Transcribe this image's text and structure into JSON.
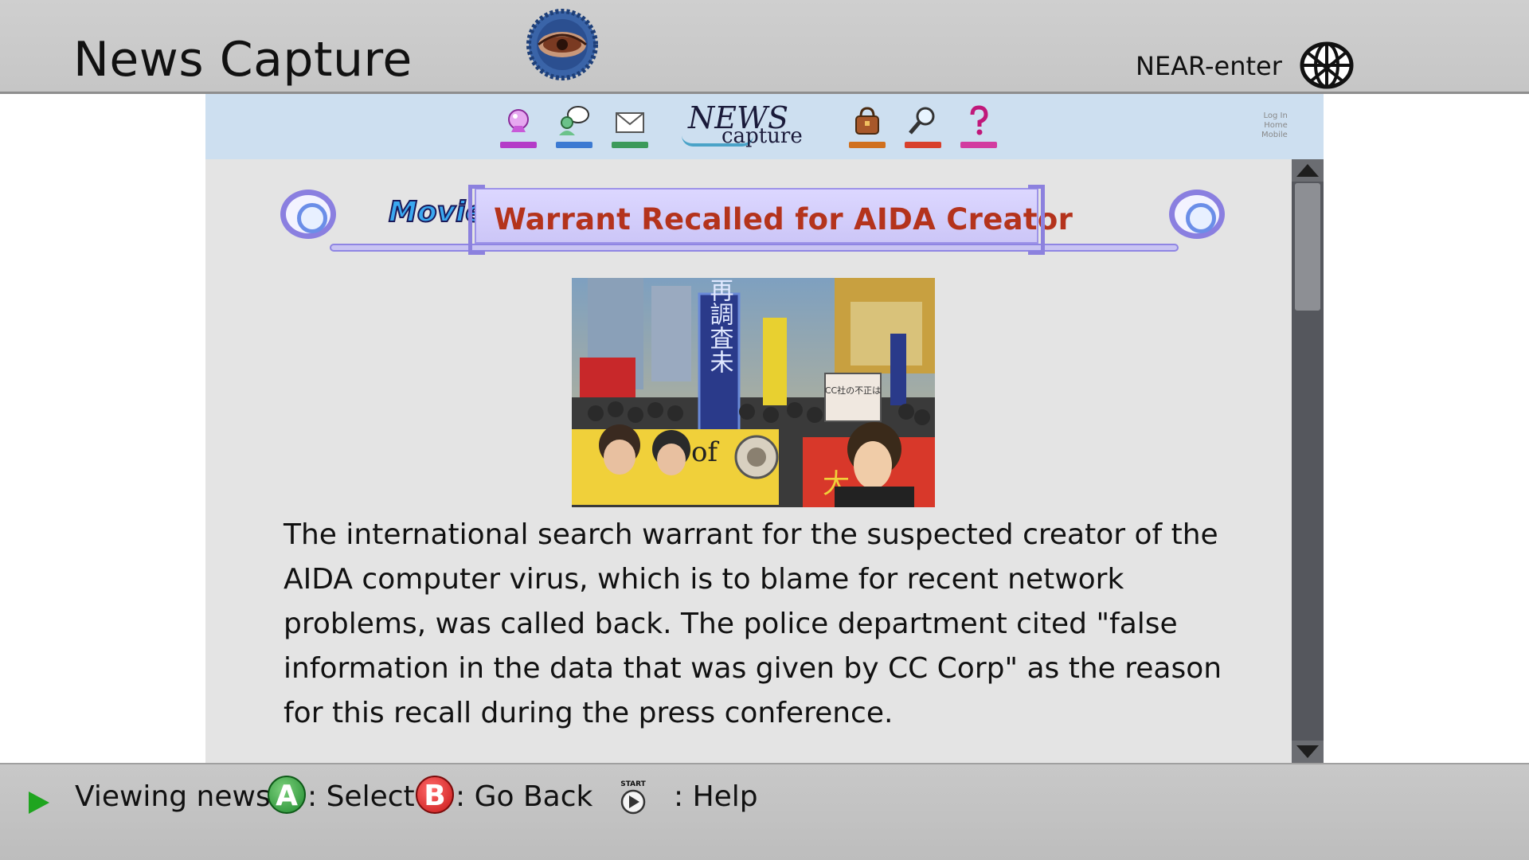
{
  "header": {
    "app_title": "News Capture",
    "network_label": "NEAR-enter",
    "logo_icon": "eye-logo-icon",
    "globe_icon": "globe-icon"
  },
  "nav": {
    "items": [
      {
        "icon": "fortune-icon",
        "color": "#b43cc8"
      },
      {
        "icon": "chat-icon",
        "color": "#3c7ad2"
      },
      {
        "icon": "mail-icon",
        "color": "#3c9a5a"
      },
      {
        "icon": "bag-icon",
        "color": "#d0701e"
      },
      {
        "icon": "search-icon",
        "color": "#d8402c"
      },
      {
        "icon": "help-icon",
        "color": "#d23ca0"
      }
    ],
    "logo_line1": "NEWS",
    "logo_line2": "capture",
    "mini_links": [
      "Log In",
      "Home",
      "Mobile"
    ]
  },
  "article": {
    "tag": "Movie",
    "headline": "Warrant Recalled for AIDA Creator",
    "body": "The international search warrant for the suspected creator of the AIDA computer virus, which is to blame for recent network problems, was called back. The police department cited \"false information in the data that was given by CC Corp\" as the reason for this recall during the press conference.",
    "picture_banner_text": "再調査未",
    "picture_sign_text": "CC社の不正は",
    "picture_banner2": "of",
    "picture_sign2": "大"
  },
  "footer": {
    "status": "Viewing news.",
    "a_key": "A",
    "a_action": ": Select",
    "b_key": "B",
    "b_action": ": Go Back",
    "start_label": "START",
    "help_action": ": Help"
  },
  "colors": {
    "header_bg": "#c9c9c9",
    "nav_band": "#cddff0",
    "headline_text": "#b4331c",
    "headline_box": "#d4cef9",
    "accent_ring": "#8a7fe0",
    "a_button": "#1f8a2e",
    "b_button": "#c81818",
    "play_arrow": "#1fa51f"
  }
}
